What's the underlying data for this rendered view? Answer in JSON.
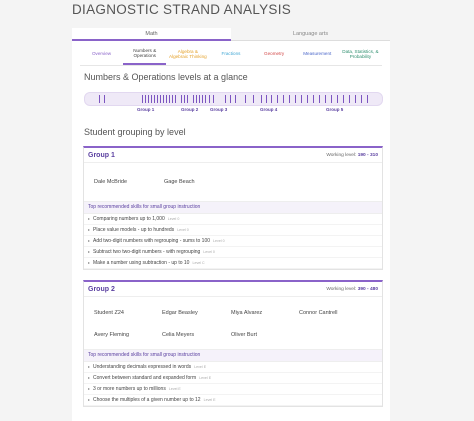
{
  "page": {
    "title": "DIAGNOSTIC STRAND ANALYSIS"
  },
  "subjects": [
    {
      "label": "Math",
      "active": true
    },
    {
      "label": "Language arts",
      "active": false
    }
  ],
  "tabs": [
    {
      "label": "Overview"
    },
    {
      "label": "Numbers & Operations"
    },
    {
      "label": "Algebra & Algebraic Thinking"
    },
    {
      "label": "Fractions"
    },
    {
      "label": "Geometry"
    },
    {
      "label": "Measurement"
    },
    {
      "label": "Data, Statistics, & Probability"
    }
  ],
  "glance": {
    "title": "Numbers & Operations levels at a glance",
    "group_labels": [
      "Group 1",
      "Group 2",
      "Group 3",
      "Group 4",
      "Group 5"
    ]
  },
  "grouping_title": "Student grouping by level",
  "groups": [
    {
      "name": "Group 1",
      "level_label": "Working level:",
      "level_range": "190 - 310",
      "students": [
        "Dale McBride",
        "Gage Beach"
      ],
      "skills_title": "Top recommended skills for small group instruction",
      "skills": [
        {
          "text": "Comparing numbers up to 1,000",
          "level": "Level 0"
        },
        {
          "text": "Place value models - up to hundreds",
          "level": "Level 0"
        },
        {
          "text": "Add two-digit numbers with regrouping - sums to 100",
          "level": "Level 0"
        },
        {
          "text": "Subtract two two-digit numbers - with regrouping",
          "level": "Level 0"
        },
        {
          "text": "Make a number using subtraction - up to 10",
          "level": "Level C"
        }
      ]
    },
    {
      "name": "Group 2",
      "level_label": "Working level:",
      "level_range": "390 - 480",
      "students": [
        "Student Z24",
        "Edgar Beasley",
        "Miya Alvarez",
        "Connor Cantrell",
        "Avery Fleming",
        "Celia Meyers",
        "Oliver Burt"
      ],
      "skills_title": "Top recommended skills for small group instruction",
      "skills": [
        {
          "text": "Understanding decimals expressed in words",
          "level": "Level E"
        },
        {
          "text": "Convert between standard and expanded form",
          "level": "Level E"
        },
        {
          "text": "3 or more numbers up to millions",
          "level": "Level E"
        },
        {
          "text": "Choose the multiples of a given number up to 12",
          "level": "Level E"
        }
      ]
    }
  ]
}
